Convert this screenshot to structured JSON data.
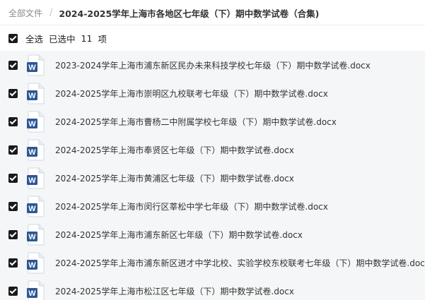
{
  "breadcrumb": {
    "root": "全部文件",
    "separator": "/",
    "current": "2024-2025学年上海市各地区七年级（下）期中数学试卷（合集)"
  },
  "toolbar": {
    "select_all_label": "全选",
    "selected_text": "已选中",
    "selected_count": "11",
    "selected_unit": "项"
  },
  "colors": {
    "accent_word": "#2b5797",
    "row_bg": "#f5f6f7",
    "checkbox": "#1a1a1a"
  },
  "file_icon": "word-document-icon",
  "files": [
    {
      "name": "2023-2024学年上海市浦东新区民办未来科技学校七年级（下）期中数学试卷.docx",
      "checked": true
    },
    {
      "name": "2024-2025学年上海市崇明区九校联考七年级（下）期中数学试卷.docx",
      "checked": true
    },
    {
      "name": "2024-2025学年上海市曹杨二中附属学校七年级（下）期中数学试卷.docx",
      "checked": true
    },
    {
      "name": "2024-2025学年上海市奉贤区七年级（下）期中数学试卷.docx",
      "checked": true
    },
    {
      "name": "2024-2025学年上海市黄浦区七年级（下）期中数学试卷.docx",
      "checked": true
    },
    {
      "name": "2024-2025学年上海市闵行区莘松中学七年级（下）期中数学试卷.docx",
      "checked": true
    },
    {
      "name": "2024-2025学年上海市浦东新区七年级（下）期中数学试卷.docx",
      "checked": true
    },
    {
      "name": "2024-2025学年上海市浦东新区进才中学北校、实验学校东校联考七年级（下）期中数学试卷.docx",
      "checked": true
    },
    {
      "name": "2024-2025学年上海市松江区七年级（下）期中数学试卷.docx",
      "checked": true
    }
  ]
}
